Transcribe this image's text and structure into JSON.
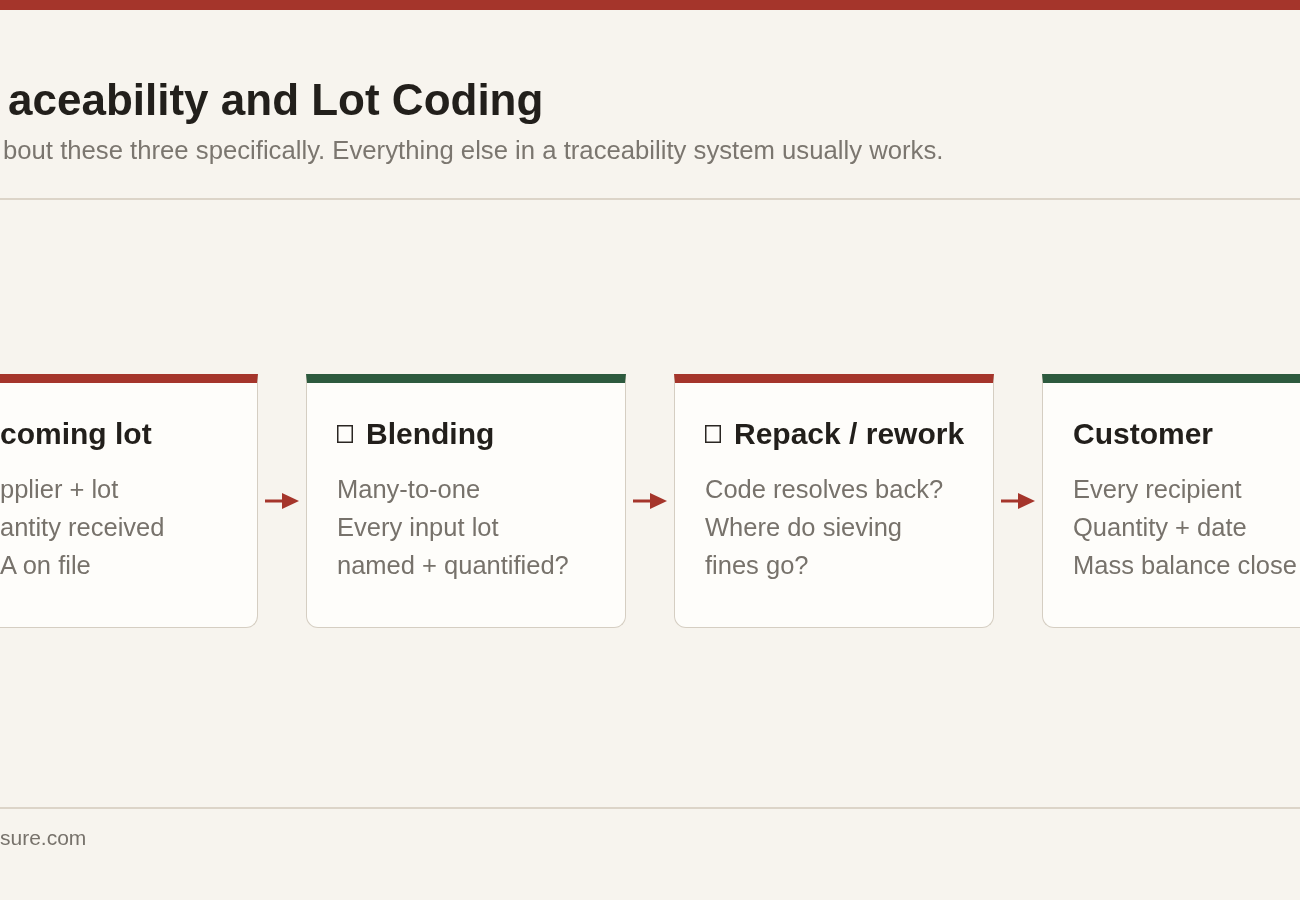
{
  "header": {
    "title": "aceability and Lot Coding",
    "subtitle": "bout these three specifically. Everything else in a traceability system usually works."
  },
  "steps": [
    {
      "title": "coming lot",
      "icon": false,
      "color": "#a5352b",
      "lines": [
        "pplier + lot",
        "antity received",
        "A on file"
      ]
    },
    {
      "title": "Blending",
      "icon": true,
      "color": "#2d5a3e",
      "lines": [
        "Many-to-one",
        "Every input lot",
        "named + quantified?"
      ]
    },
    {
      "title": "Repack / rework",
      "icon": true,
      "color": "#a5352b",
      "lines": [
        "Code resolves back?",
        "Where do sieving",
        "fines go?"
      ]
    },
    {
      "title": "Customer",
      "icon": false,
      "color": "#2d5a3e",
      "lines": [
        "Every recipient",
        "Quantity + date",
        "Mass balance close"
      ]
    }
  ],
  "footer": {
    "text": "sure.com"
  }
}
